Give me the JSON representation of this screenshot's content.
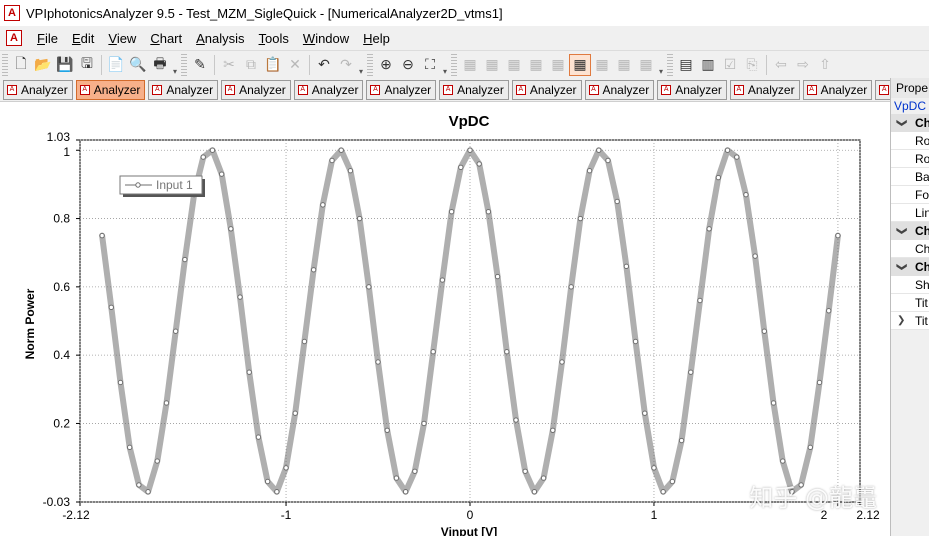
{
  "window": {
    "title": "VPIphotonicsAnalyzer 9.5 - Test_MZM_SigleQuick - [NumericalAnalyzer2D_vtms1]",
    "app_icon_glyph": "A"
  },
  "menu": [
    "File",
    "Edit",
    "View",
    "Chart",
    "Analysis",
    "Tools",
    "Window",
    "Help"
  ],
  "toolbar": [
    {
      "icon": "new-file-icon",
      "glyph": "🗋",
      "enabled": true
    },
    {
      "icon": "open-folder-icon",
      "glyph": "📂",
      "enabled": true
    },
    {
      "icon": "save-icon",
      "glyph": "💾",
      "enabled": true
    },
    {
      "icon": "save-all-icon",
      "glyph": "🖫",
      "enabled": true
    },
    {
      "sep": true
    },
    {
      "icon": "document-icon",
      "glyph": "📄",
      "enabled": true
    },
    {
      "icon": "print-preview-icon",
      "glyph": "🔍",
      "enabled": true
    },
    {
      "icon": "print-icon",
      "glyph": "🖶",
      "enabled": true
    },
    {
      "grip": true
    },
    {
      "icon": "properties-icon",
      "glyph": "✎",
      "enabled": true
    },
    {
      "sep": true
    },
    {
      "icon": "cut-icon",
      "glyph": "✂",
      "enabled": false
    },
    {
      "icon": "copy-icon",
      "glyph": "⧉",
      "enabled": false
    },
    {
      "icon": "paste-icon",
      "glyph": "📋",
      "enabled": false
    },
    {
      "icon": "delete-icon",
      "glyph": "✕",
      "enabled": false
    },
    {
      "sep": true
    },
    {
      "icon": "undo-icon",
      "glyph": "↶",
      "enabled": true
    },
    {
      "icon": "redo-icon",
      "glyph": "↷",
      "enabled": false
    },
    {
      "grip": true
    },
    {
      "icon": "zoom-in-icon",
      "glyph": "⊕",
      "enabled": true
    },
    {
      "icon": "zoom-out-icon",
      "glyph": "⊖",
      "enabled": true
    },
    {
      "icon": "zoom-fit-icon",
      "glyph": "⛶",
      "enabled": true
    },
    {
      "grip": true
    },
    {
      "icon": "layout-1-icon",
      "glyph": "▦",
      "enabled": false
    },
    {
      "icon": "layout-2-icon",
      "glyph": "▦",
      "enabled": false
    },
    {
      "icon": "layout-3-icon",
      "glyph": "▦",
      "enabled": false
    },
    {
      "icon": "layout-4-icon",
      "glyph": "▦",
      "enabled": false
    },
    {
      "icon": "layout-5-icon",
      "glyph": "▦",
      "enabled": false
    },
    {
      "icon": "layout-6-icon",
      "glyph": "▦",
      "enabled": true,
      "active": true
    },
    {
      "icon": "layout-7-icon",
      "glyph": "▦",
      "enabled": false
    },
    {
      "icon": "layout-8-icon",
      "glyph": "▦",
      "enabled": false
    },
    {
      "icon": "layout-9-icon",
      "glyph": "▦",
      "enabled": false
    },
    {
      "grip": true
    },
    {
      "icon": "chart-grid-icon",
      "glyph": "▤",
      "enabled": true
    },
    {
      "icon": "chart-table-icon",
      "glyph": "▥",
      "enabled": true
    },
    {
      "icon": "chart-check-icon",
      "glyph": "☑",
      "enabled": false
    },
    {
      "icon": "chart-export-icon",
      "glyph": "⎘",
      "enabled": false
    },
    {
      "sep": true
    },
    {
      "icon": "back-icon",
      "glyph": "⇦",
      "enabled": false
    },
    {
      "icon": "forward-icon",
      "glyph": "⇨",
      "enabled": false
    },
    {
      "icon": "home-icon",
      "glyph": "⇧",
      "enabled": false
    }
  ],
  "tabs": [
    {
      "label": "Analyzer",
      "active": false
    },
    {
      "label": "Analyzer",
      "active": true
    },
    {
      "label": "Analyzer",
      "active": false
    },
    {
      "label": "Analyzer",
      "active": false
    },
    {
      "label": "Analyzer",
      "active": false
    },
    {
      "label": "Analyzer",
      "active": false
    },
    {
      "label": "Analyzer",
      "active": false
    },
    {
      "label": "Analyzer",
      "active": false
    },
    {
      "label": "Analyzer",
      "active": false
    },
    {
      "label": "Analyzer",
      "active": false
    },
    {
      "label": "Analyzer",
      "active": false
    },
    {
      "label": "Analyzer",
      "active": false
    },
    {
      "label": "Analyzer",
      "active": false
    }
  ],
  "properties_panel": {
    "header": "Prope",
    "subheader": "VpDC",
    "rows": [
      {
        "type": "category",
        "label": "Ch",
        "expanded": true
      },
      {
        "type": "item",
        "label": "Ro"
      },
      {
        "type": "item",
        "label": "Ro"
      },
      {
        "type": "item",
        "label": "Ba"
      },
      {
        "type": "item",
        "label": "Fo"
      },
      {
        "type": "item",
        "label": "Lin"
      },
      {
        "type": "category",
        "label": "Ch",
        "expanded": true
      },
      {
        "type": "item",
        "label": "Ch"
      },
      {
        "type": "category",
        "label": "Ch",
        "expanded": true
      },
      {
        "type": "item",
        "label": "Sh"
      },
      {
        "type": "item",
        "label": "Tit"
      },
      {
        "type": "item",
        "label": "Tit",
        "collapsed_node": true
      }
    ]
  },
  "chart_data": {
    "type": "scatter",
    "title": "VpDC",
    "xlabel": "Vinput [V]",
    "ylabel": "Norm Power",
    "xlim": [
      -2.12,
      2.12
    ],
    "ylim": [
      -0.03,
      1.03
    ],
    "x_tick_labels": [
      "-2.12",
      "-1",
      "0",
      "1",
      "2",
      "2.12"
    ],
    "x_ticks": [
      -2.12,
      -1,
      0,
      1,
      2,
      2.12
    ],
    "y_tick_labels": [
      "1.03",
      "1",
      "0.8",
      "0.6",
      "0.4",
      "0.2",
      "-0.03"
    ],
    "y_ticks": [
      1.03,
      1,
      0.8,
      0.6,
      0.4,
      0.2,
      -0.03
    ],
    "grid": true,
    "legend": {
      "placement": "top-left",
      "entries": [
        "Input 1"
      ]
    },
    "series": [
      {
        "name": "Input 1",
        "color": "#6e6e6e",
        "marker": "open-circle",
        "x": [
          -2.0,
          -1.95,
          -1.9,
          -1.85,
          -1.8,
          -1.75,
          -1.7,
          -1.65,
          -1.6,
          -1.55,
          -1.5,
          -1.45,
          -1.4,
          -1.35,
          -1.3,
          -1.25,
          -1.2,
          -1.15,
          -1.1,
          -1.05,
          -1.0,
          -0.95,
          -0.9,
          -0.85,
          -0.8,
          -0.75,
          -0.7,
          -0.65,
          -0.6,
          -0.55,
          -0.5,
          -0.45,
          -0.4,
          -0.35,
          -0.3,
          -0.25,
          -0.2,
          -0.15,
          -0.1,
          -0.05,
          0.0,
          0.05,
          0.1,
          0.15,
          0.2,
          0.25,
          0.3,
          0.35,
          0.4,
          0.45,
          0.5,
          0.55,
          0.6,
          0.65,
          0.7,
          0.75,
          0.8,
          0.85,
          0.9,
          0.95,
          1.0,
          1.05,
          1.1,
          1.15,
          1.2,
          1.25,
          1.3,
          1.35,
          1.4,
          1.45,
          1.5,
          1.55,
          1.6,
          1.65,
          1.7,
          1.75,
          1.8,
          1.85,
          1.9,
          1.95,
          2.0
        ],
        "y": [
          0.75,
          0.54,
          0.32,
          0.13,
          0.02,
          0.0,
          0.09,
          0.26,
          0.47,
          0.68,
          0.87,
          0.98,
          1.0,
          0.93,
          0.77,
          0.57,
          0.35,
          0.16,
          0.03,
          0.0,
          0.07,
          0.23,
          0.44,
          0.65,
          0.84,
          0.97,
          1.0,
          0.94,
          0.8,
          0.6,
          0.38,
          0.18,
          0.04,
          0.0,
          0.06,
          0.2,
          0.41,
          0.62,
          0.82,
          0.95,
          1.0,
          0.96,
          0.82,
          0.63,
          0.41,
          0.21,
          0.06,
          0.0,
          0.04,
          0.18,
          0.38,
          0.6,
          0.8,
          0.94,
          1.0,
          0.97,
          0.85,
          0.66,
          0.44,
          0.23,
          0.07,
          0.0,
          0.03,
          0.15,
          0.35,
          0.56,
          0.77,
          0.92,
          1.0,
          0.98,
          0.87,
          0.69,
          0.47,
          0.26,
          0.09,
          0.0,
          0.02,
          0.13,
          0.32,
          0.53,
          0.75
        ]
      }
    ]
  },
  "watermark": "知乎 @龍鼉"
}
